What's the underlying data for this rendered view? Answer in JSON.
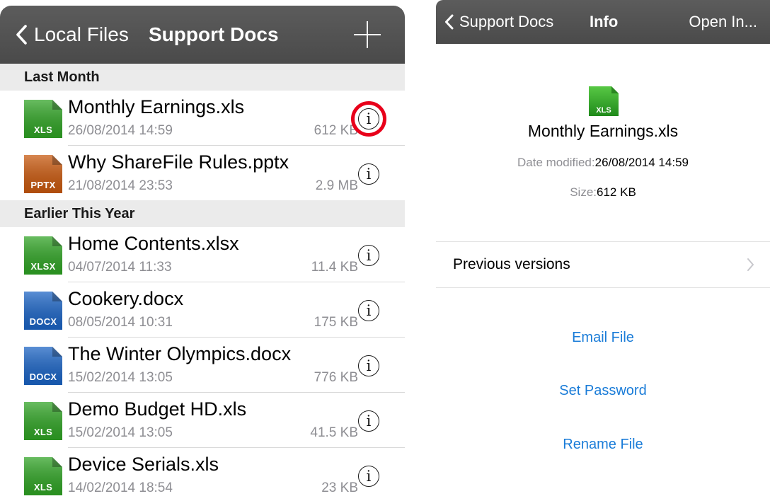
{
  "left": {
    "back_label": "Local Files",
    "title": "Support Docs",
    "add_icon": "plus-icon",
    "sections": [
      {
        "header": "Last Month",
        "files": [
          {
            "name": "Monthly Earnings.xls",
            "date": "26/08/2014 14:59",
            "size": "612 KB",
            "ext": "XLS",
            "color": "#2fa324"
          },
          {
            "name": "Why ShareFile Rules.pptx",
            "date": "21/08/2014 23:53",
            "size": "2.9 MB",
            "ext": "PPTX",
            "color": "#c8580d"
          }
        ]
      },
      {
        "header": "Earlier This Year",
        "files": [
          {
            "name": "Home Contents.xlsx",
            "date": "04/07/2014 11:33",
            "size": "11.4 KB",
            "ext": "XLSX",
            "color": "#2fa324"
          },
          {
            "name": "Cookery.docx",
            "date": "08/05/2014 10:31",
            "size": "175 KB",
            "ext": "DOCX",
            "color": "#1a63c4"
          },
          {
            "name": "The Winter Olympics.docx",
            "date": "15/02/2014 13:05",
            "size": "776 KB",
            "ext": "DOCX",
            "color": "#1a63c4"
          },
          {
            "name": "Demo Budget HD.xls",
            "date": "15/02/2014 13:05",
            "size": "41.5 KB",
            "ext": "XLS",
            "color": "#2fa324"
          },
          {
            "name": "Device Serials.xls",
            "date": "14/02/2014 18:54",
            "size": "23 KB",
            "ext": "XLS",
            "color": "#2fa324"
          }
        ]
      }
    ],
    "info_glyph": "i",
    "highlight_color": "#e8001a"
  },
  "right": {
    "back_label": "Support Docs",
    "title": "Info",
    "open_in": "Open In...",
    "file": {
      "ext": "XLS",
      "color": "#2fa324",
      "name": "Monthly Earnings.xls",
      "date_label": "Date modified:",
      "date_value": "26/08/2014 14:59",
      "size_label": "Size:",
      "size_value": "612 KB"
    },
    "previous_versions": "Previous versions",
    "actions": [
      "Email File",
      "Set Password",
      "Rename File"
    ],
    "accent": "#1a7cd8"
  }
}
